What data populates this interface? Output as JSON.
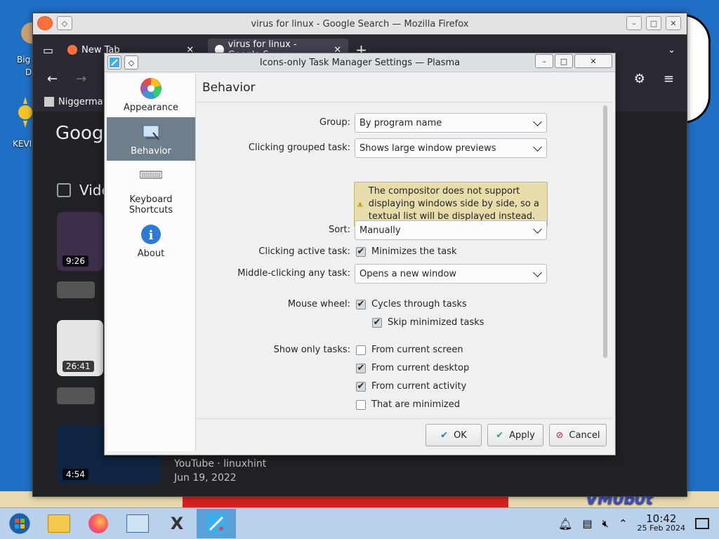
{
  "desktop": {
    "icon_label_1": "Big",
    "icon_label_1b": "D",
    "icon_label_2": "KEVI",
    "wallpaper_text": "VM0b0t"
  },
  "firefox": {
    "window_title": "virus for linux - Google Search — Mozilla Firefox",
    "tabs": [
      {
        "label": "New Tab"
      },
      {
        "label": "virus for linux - Google S"
      }
    ],
    "bookmark_label": "Niggerma",
    "google_logo": "Googl",
    "videos_heading": "Vide",
    "durations": [
      "9:26",
      "26:41",
      "4:54"
    ],
    "result_source": "YouTube · linuxhint",
    "result_date": "Jun 19, 2022"
  },
  "dialog": {
    "title": "Icons-only Task Manager Settings — Plasma",
    "page_title": "Behavior",
    "sidebar": [
      {
        "label": "Appearance",
        "icon": "appearance-icon"
      },
      {
        "label": "Behavior",
        "icon": "behavior-icon"
      },
      {
        "label": "Keyboard Shortcuts",
        "icon": "keyboard-icon"
      },
      {
        "label": "About",
        "icon": "info-icon"
      }
    ],
    "group": {
      "label": "Group:",
      "value": "By program name"
    },
    "clicking_grouped": {
      "label": "Clicking grouped task:",
      "value": "Shows large window previews"
    },
    "warning": "The compositor does not support displaying windows side by side, so a textual list will be displayed instead.",
    "sort": {
      "label": "Sort:",
      "value": "Manually"
    },
    "clicking_active": {
      "label": "Clicking active task:",
      "checkbox": "Minimizes the task",
      "checked": true
    },
    "middle_click": {
      "label": "Middle-clicking any task:",
      "value": "Opens a new window"
    },
    "mouse_wheel": {
      "label": "Mouse wheel:",
      "cycles": "Cycles through tasks",
      "cycles_checked": true,
      "skip": "Skip minimized tasks",
      "skip_checked": true
    },
    "show_only": {
      "label": "Show only tasks:",
      "options": [
        {
          "text": "From current screen",
          "checked": false
        },
        {
          "text": "From current desktop",
          "checked": true
        },
        {
          "text": "From current activity",
          "checked": true
        },
        {
          "text": "That are minimized",
          "checked": false
        }
      ]
    },
    "buttons": {
      "ok": "OK",
      "apply": "Apply",
      "cancel": "Cancel"
    }
  },
  "taskbar": {
    "time": "10:42",
    "date": "25 Feb 2024"
  }
}
